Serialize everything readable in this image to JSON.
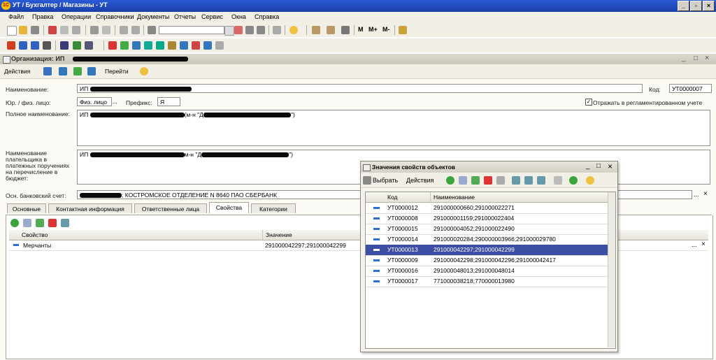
{
  "app": {
    "title": "УТ / Бухгалтер / Магазины - УТ",
    "logo": "1С",
    "window_buttons": [
      "_",
      "▫",
      "×"
    ]
  },
  "menu": [
    "Файл",
    "Правка",
    "Операции",
    "Справочники",
    "Документы",
    "Отчеты",
    "Сервис",
    "Окна",
    "Справка"
  ],
  "toolbar": {
    "search_value": "",
    "mem_buttons": [
      "M",
      "M+",
      "M-"
    ]
  },
  "document": {
    "title": "Организация: ИП",
    "actions_label": "Действия",
    "goto_label": "Перейти",
    "fields": {
      "name_label": "Наименование:",
      "name_value": "ИП",
      "code_label": "Код:",
      "code_value": "УТ0000007",
      "type_label": "Юр. / физ. лицо:",
      "type_value": "Физ. лицо",
      "prefix_label": "Префикс:",
      "prefix_value": "Я",
      "reglament_label": "Отражать в регламентированном учете",
      "fullname_label": "Полное наименование:",
      "fullname_value": "ИП",
      "fullname_mid": "(м-н \"Д",
      "fullname_end": "\")",
      "payer_label": "Наименование плательщика в платежных поручениях на перечисление в бюджет:",
      "payer_value": "ИП",
      "payer_mid": "м-н \"Д",
      "payer_end": "\")",
      "bank_label": "Осн. банковский счет:",
      "bank_value": "; КОСТРОМСКОЕ ОТДЕЛЕНИЕ N 8640 ПАО СБЕРБАНК"
    },
    "tabs": [
      "Основные",
      "Контактная информация",
      "Ответственные лица",
      "Свойства",
      "Категории"
    ],
    "active_tab": 3,
    "grid": {
      "headers": [
        "Свойство",
        "Значение"
      ],
      "rows": [
        {
          "property": "Мерчанты",
          "value": "291000042297;291000042299"
        }
      ]
    }
  },
  "popup": {
    "title": "Значения свойств объектов",
    "select_label": "Выбрать",
    "actions_label": "Действия",
    "headers": [
      "Код",
      "Наименование"
    ],
    "rows": [
      {
        "code": "УТ0000012",
        "name": "291000000660;291000022271"
      },
      {
        "code": "УТ0000008",
        "name": "291000001159;291000022404"
      },
      {
        "code": "УТ0000015",
        "name": "291000004052;291000022490"
      },
      {
        "code": "УТ0000014",
        "name": "291000020284;290000003966;291000029780"
      },
      {
        "code": "УТ0000013",
        "name": "291000042297;291000042299",
        "selected": true
      },
      {
        "code": "УТ0000009",
        "name": "291000042298;291000042296;291000042417"
      },
      {
        "code": "УТ0000016",
        "name": "291000048013;291000048014"
      },
      {
        "code": "УТ0000017",
        "name": "771000038218;770000013980"
      }
    ]
  },
  "colors": {
    "titlebar": "#2358d2",
    "selection": "#3d4ea5",
    "window_bg": "#fbfaf5"
  }
}
